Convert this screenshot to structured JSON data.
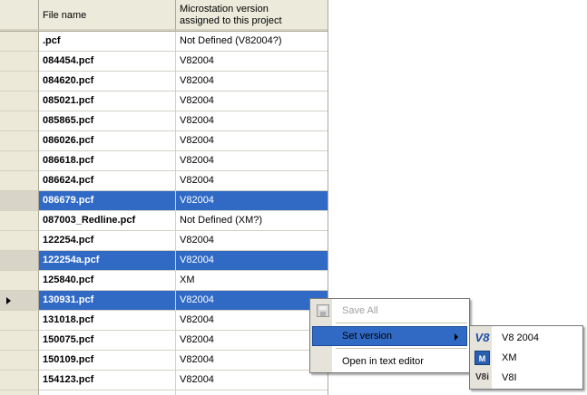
{
  "grid": {
    "headers": {
      "file_name": "File name",
      "version_line1": "Microstation version",
      "version_line2": "assigned to this project"
    },
    "rows": [
      {
        "file": ".pcf",
        "version": "Not Defined (V82004?)",
        "selected": false,
        "current": false
      },
      {
        "file": "084454.pcf",
        "version": "V82004",
        "selected": false,
        "current": false
      },
      {
        "file": "084620.pcf",
        "version": "V82004",
        "selected": false,
        "current": false
      },
      {
        "file": "085021.pcf",
        "version": "V82004",
        "selected": false,
        "current": false
      },
      {
        "file": "085865.pcf",
        "version": "V82004",
        "selected": false,
        "current": false
      },
      {
        "file": "086026.pcf",
        "version": "V82004",
        "selected": false,
        "current": false
      },
      {
        "file": "086618.pcf",
        "version": "V82004",
        "selected": false,
        "current": false
      },
      {
        "file": "086624.pcf",
        "version": "V82004",
        "selected": false,
        "current": false
      },
      {
        "file": "086679.pcf",
        "version": "V82004",
        "selected": true,
        "current": false
      },
      {
        "file": "087003_Redline.pcf",
        "version": "Not Defined (XM?)",
        "selected": false,
        "current": false
      },
      {
        "file": "122254.pcf",
        "version": "V82004",
        "selected": false,
        "current": false
      },
      {
        "file": "122254a.pcf",
        "version": "V82004",
        "selected": true,
        "current": false
      },
      {
        "file": "125840.pcf",
        "version": "XM",
        "selected": false,
        "current": false
      },
      {
        "file": "130931.pcf",
        "version": "V82004",
        "selected": true,
        "current": true
      },
      {
        "file": "131018.pcf",
        "version": "V82004",
        "selected": false,
        "current": false
      },
      {
        "file": "150075.pcf",
        "version": "V82004",
        "selected": false,
        "current": false
      },
      {
        "file": "150109.pcf",
        "version": "V82004",
        "selected": false,
        "current": false
      },
      {
        "file": "154123.pcf",
        "version": "V82004",
        "selected": false,
        "current": false
      },
      {
        "file": "",
        "version": "",
        "selected": false,
        "current": false
      }
    ]
  },
  "context_menu": {
    "save_all": "Save All",
    "save_all_icon": "floppy-disk-icon",
    "set_version": "Set version",
    "open_in_text_editor": "Open in text editor"
  },
  "submenu": {
    "items": [
      {
        "label": "V8 2004",
        "icon": "v8-icon",
        "icon_text": "V8"
      },
      {
        "label": "XM",
        "icon": "xm-icon",
        "icon_text": "M"
      },
      {
        "label": "V8I",
        "icon": "v8i-icon",
        "icon_text": "V8i"
      }
    ]
  },
  "colors": {
    "selection": "#316ac5",
    "header_bg": "#ece9d8",
    "menu_gutter": "#e6e3da"
  }
}
